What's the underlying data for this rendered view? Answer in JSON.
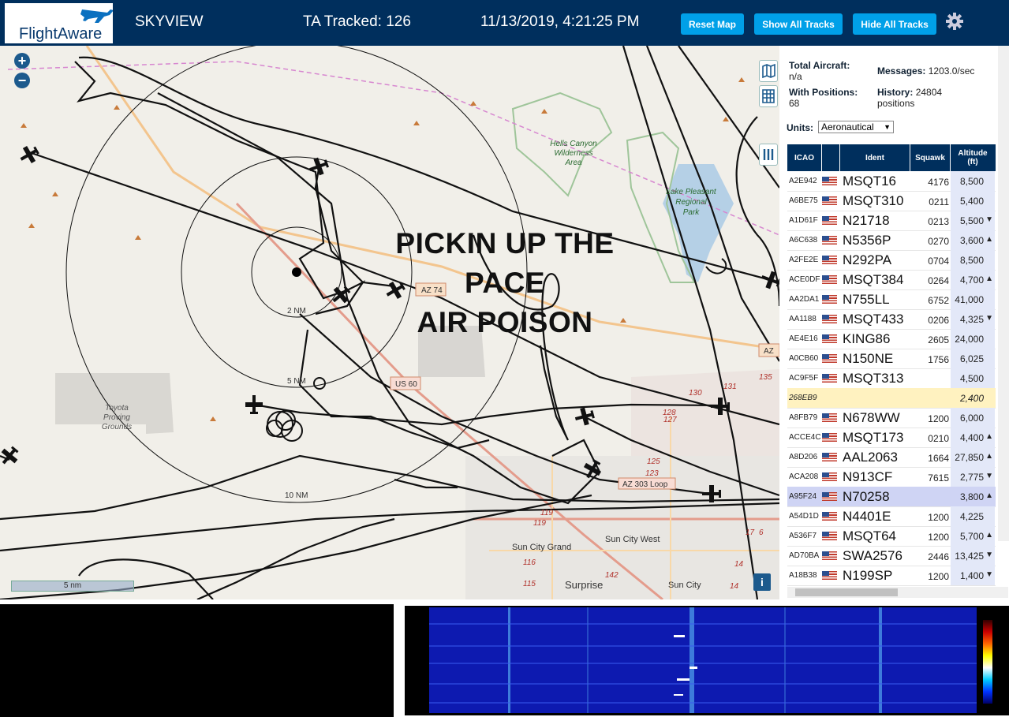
{
  "header": {
    "logo_text": "FlightAware",
    "app_name": "SKYVIEW",
    "tracked": "TA Tracked: 126",
    "datetime": "11/13/2019, 4:21:25 PM",
    "buttons": {
      "reset": "Reset Map",
      "show_all": "Show All Tracks",
      "hide_all": "Hide All Tracks"
    }
  },
  "map": {
    "zoom_in": "+",
    "zoom_out": "−",
    "overlay_line1": "PICKIN UP THE PACE",
    "overlay_line2": "AIR POISON",
    "scale_label": "5 nm",
    "info_label": "i",
    "ring_labels": {
      "r2": "2 NM",
      "r5": "5 NM",
      "r10": "10 NM"
    },
    "places": {
      "hells_canyon": [
        "Hells Canyon",
        "Wilderness",
        "Area"
      ],
      "lake_pleasant": [
        "Lake Pleasant",
        "Regional",
        "Park"
      ],
      "toyota": [
        "Toyota",
        "Proving",
        "Grounds"
      ],
      "sun_city_grand": "Sun City Grand",
      "sun_city_west": "Sun City West",
      "surprise": "Surprise",
      "sun_city": "Sun City",
      "az74": "AZ 74",
      "us60": "US 60",
      "az303": "AZ 303 Loop",
      "az": "AZ",
      "route_nums": [
        "130",
        "131",
        "135",
        "128",
        "127",
        "125",
        "123",
        "119",
        "119",
        "116",
        "115",
        "142",
        "14",
        "14",
        "17",
        "6"
      ]
    }
  },
  "panel": {
    "total_label": "Total Aircraft:",
    "total_value": "n/a",
    "messages_label": "Messages:",
    "messages_value": "1203.0/sec",
    "with_pos_label": "With Positions:",
    "with_pos_value": "68",
    "history_label": "History:",
    "history_value": "24804",
    "history_unit": "positions",
    "units_label": "Units:",
    "units_value": "Aeronautical",
    "columns": {
      "icao": "ICAO",
      "ident": "Ident",
      "squawk": "Squawk",
      "alt1": "Altitude",
      "alt2": "(ft)"
    },
    "rows": [
      {
        "icao": "A2E942",
        "ident": "MSQT16",
        "squawk": "4176",
        "alt": "8,500",
        "trend": ""
      },
      {
        "icao": "A6BE75",
        "ident": "MSQT310",
        "squawk": "0211",
        "alt": "5,400",
        "trend": ""
      },
      {
        "icao": "A1D61F",
        "ident": "N21718",
        "squawk": "0213",
        "alt": "5,500",
        "trend": "▼"
      },
      {
        "icao": "A6C638",
        "ident": "N5356P",
        "squawk": "0270",
        "alt": "3,600",
        "trend": "▲"
      },
      {
        "icao": "A2FE2E",
        "ident": "N292PA",
        "squawk": "0704",
        "alt": "8,500",
        "trend": ""
      },
      {
        "icao": "ACE0DF",
        "ident": "MSQT384",
        "squawk": "0264",
        "alt": "4,700",
        "trend": "▲"
      },
      {
        "icao": "AA2DA1",
        "ident": "N755LL",
        "squawk": "6752",
        "alt": "41,000",
        "trend": ""
      },
      {
        "icao": "AA1188",
        "ident": "MSQT433",
        "squawk": "0206",
        "alt": "4,325",
        "trend": "▼"
      },
      {
        "icao": "AE4E16",
        "ident": "KING86",
        "squawk": "2605",
        "alt": "24,000",
        "trend": ""
      },
      {
        "icao": "A0CB60",
        "ident": "N150NE",
        "squawk": "1756",
        "alt": "6,025",
        "trend": ""
      },
      {
        "icao": "AC9F5F",
        "ident": "MSQT313",
        "squawk": "",
        "alt": "4,500",
        "trend": ""
      },
      {
        "icao": "268EB9",
        "ident": "",
        "squawk": "",
        "alt": "2,400",
        "trend": "",
        "special": "yellow"
      },
      {
        "icao": "A8FB79",
        "ident": "N678WW",
        "squawk": "1200",
        "alt": "6,000",
        "trend": ""
      },
      {
        "icao": "ACCE4C",
        "ident": "MSQT173",
        "squawk": "0210",
        "alt": "4,400",
        "trend": "▲"
      },
      {
        "icao": "A8D206",
        "ident": "AAL2063",
        "squawk": "1664",
        "alt": "27,850",
        "trend": "▲"
      },
      {
        "icao": "ACA208",
        "ident": "N913CF",
        "squawk": "7615",
        "alt": "2,775",
        "trend": "▼"
      },
      {
        "icao": "A95F24",
        "ident": "N70258",
        "squawk": "",
        "alt": "3,800",
        "trend": "▲",
        "special": "selected"
      },
      {
        "icao": "A54D1D",
        "ident": "N4401E",
        "squawk": "1200",
        "alt": "4,225",
        "trend": ""
      },
      {
        "icao": "A536F7",
        "ident": "MSQT64",
        "squawk": "1200",
        "alt": "5,700",
        "trend": "▲"
      },
      {
        "icao": "AD70BA",
        "ident": "SWA2576",
        "squawk": "2446",
        "alt": "13,425",
        "trend": "▼"
      },
      {
        "icao": "A18B38",
        "ident": "N199SP",
        "squawk": "1200",
        "alt": "1,400",
        "trend": "▼"
      }
    ]
  },
  "colors": {
    "header_bg": "#002f5d",
    "button": "#00a0e8",
    "alt_col": "#e3e8f8",
    "selected": "#cfd4f4",
    "yellow": "#fff2c0"
  },
  "icons": [
    "plus-icon",
    "minus-icon",
    "map-layer-icon",
    "grid-icon",
    "columns-icon",
    "gear-icon",
    "airplane-icon",
    "info-icon",
    "us-flag-icon"
  ]
}
